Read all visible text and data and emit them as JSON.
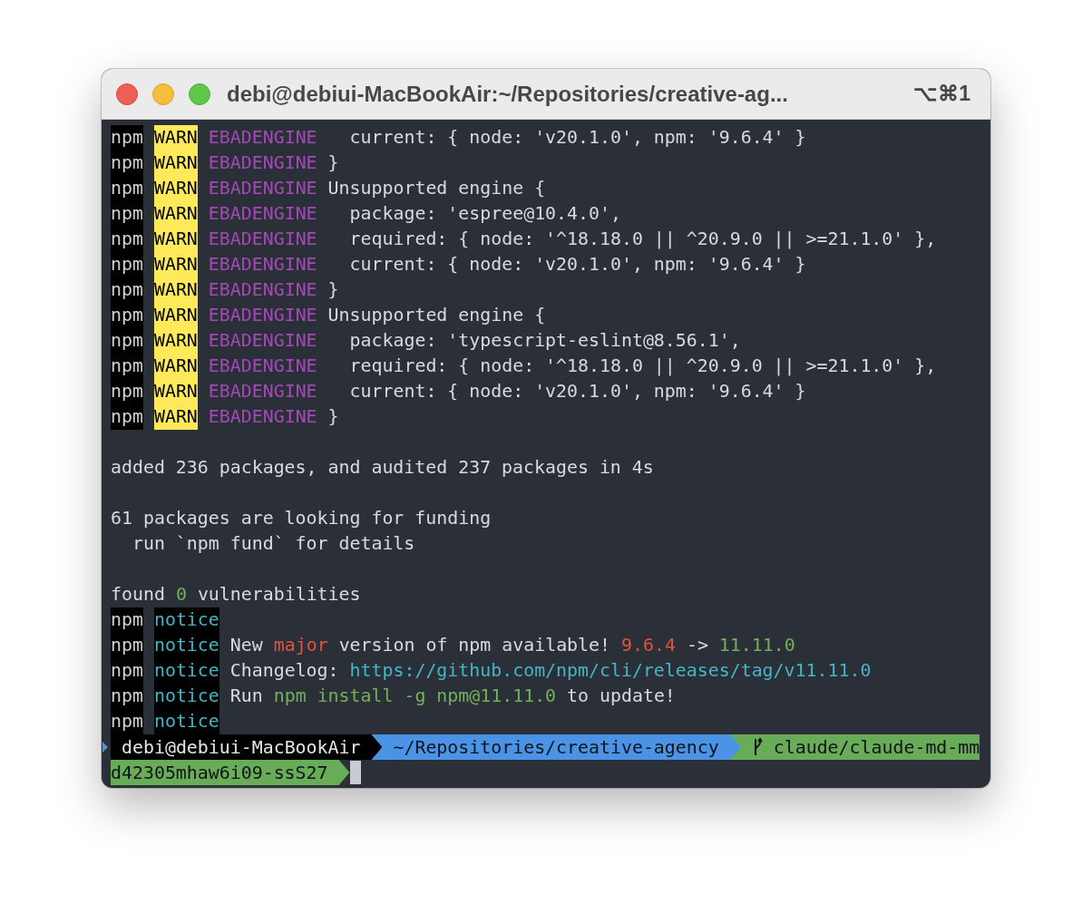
{
  "window": {
    "title": "debi@debiui-MacBookAir:~/Repositories/creative-ag...",
    "shortcut": "⌥⌘1"
  },
  "lines": [
    {
      "kind": "log",
      "segments": [
        {
          "kind": "prefix",
          "text": "npm"
        },
        {
          "kind": "warn",
          "text": "WARN"
        },
        {
          "kind": "code",
          "text": "EBADENGINE"
        },
        {
          "kind": "text",
          "text": "  current: { node: 'v20.1.0', npm: '9.6.4' }"
        }
      ]
    },
    {
      "kind": "log",
      "segments": [
        {
          "kind": "prefix",
          "text": "npm"
        },
        {
          "kind": "warn",
          "text": "WARN"
        },
        {
          "kind": "code",
          "text": "EBADENGINE"
        },
        {
          "kind": "text",
          "text": "}"
        }
      ]
    },
    {
      "kind": "log",
      "segments": [
        {
          "kind": "prefix",
          "text": "npm"
        },
        {
          "kind": "warn",
          "text": "WARN"
        },
        {
          "kind": "code",
          "text": "EBADENGINE"
        },
        {
          "kind": "text",
          "text": "Unsupported engine {"
        }
      ]
    },
    {
      "kind": "log",
      "segments": [
        {
          "kind": "prefix",
          "text": "npm"
        },
        {
          "kind": "warn",
          "text": "WARN"
        },
        {
          "kind": "code",
          "text": "EBADENGINE"
        },
        {
          "kind": "text",
          "text": "  package: 'espree@10.4.0',"
        }
      ]
    },
    {
      "kind": "log",
      "segments": [
        {
          "kind": "prefix",
          "text": "npm"
        },
        {
          "kind": "warn",
          "text": "WARN"
        },
        {
          "kind": "code",
          "text": "EBADENGINE"
        },
        {
          "kind": "text",
          "text": "  required: { node: '^18.18.0 || ^20.9.0 || >=21.1.0' },"
        }
      ]
    },
    {
      "kind": "log",
      "segments": [
        {
          "kind": "prefix",
          "text": "npm"
        },
        {
          "kind": "warn",
          "text": "WARN"
        },
        {
          "kind": "code",
          "text": "EBADENGINE"
        },
        {
          "kind": "text",
          "text": "  current: { node: 'v20.1.0', npm: '9.6.4' }"
        }
      ]
    },
    {
      "kind": "log",
      "segments": [
        {
          "kind": "prefix",
          "text": "npm"
        },
        {
          "kind": "warn",
          "text": "WARN"
        },
        {
          "kind": "code",
          "text": "EBADENGINE"
        },
        {
          "kind": "text",
          "text": "}"
        }
      ]
    },
    {
      "kind": "log",
      "segments": [
        {
          "kind": "prefix",
          "text": "npm"
        },
        {
          "kind": "warn",
          "text": "WARN"
        },
        {
          "kind": "code",
          "text": "EBADENGINE"
        },
        {
          "kind": "text",
          "text": "Unsupported engine {"
        }
      ]
    },
    {
      "kind": "log",
      "segments": [
        {
          "kind": "prefix",
          "text": "npm"
        },
        {
          "kind": "warn",
          "text": "WARN"
        },
        {
          "kind": "code",
          "text": "EBADENGINE"
        },
        {
          "kind": "text",
          "text": "  package: 'typescript-eslint@8.56.1',"
        }
      ]
    },
    {
      "kind": "log",
      "segments": [
        {
          "kind": "prefix",
          "text": "npm"
        },
        {
          "kind": "warn",
          "text": "WARN"
        },
        {
          "kind": "code",
          "text": "EBADENGINE"
        },
        {
          "kind": "text",
          "text": "  required: { node: '^18.18.0 || ^20.9.0 || >=21.1.0' },"
        }
      ]
    },
    {
      "kind": "log",
      "segments": [
        {
          "kind": "prefix",
          "text": "npm"
        },
        {
          "kind": "warn",
          "text": "WARN"
        },
        {
          "kind": "code",
          "text": "EBADENGINE"
        },
        {
          "kind": "text",
          "text": "  current: { node: 'v20.1.0', npm: '9.6.4' }"
        }
      ]
    },
    {
      "kind": "log",
      "segments": [
        {
          "kind": "prefix",
          "text": "npm"
        },
        {
          "kind": "warn",
          "text": "WARN"
        },
        {
          "kind": "code",
          "text": "EBADENGINE"
        },
        {
          "kind": "text",
          "text": "}"
        }
      ]
    },
    {
      "kind": "blank"
    },
    {
      "kind": "log",
      "segments": [
        {
          "kind": "text",
          "text": "added 236 packages, and audited 237 packages in 4s"
        }
      ]
    },
    {
      "kind": "blank"
    },
    {
      "kind": "log",
      "segments": [
        {
          "kind": "text",
          "text": "61 packages are looking for funding"
        }
      ]
    },
    {
      "kind": "log",
      "segments": [
        {
          "kind": "text",
          "text": "  run `npm fund` for details"
        }
      ]
    },
    {
      "kind": "blank"
    },
    {
      "kind": "log",
      "segments": [
        {
          "kind": "text",
          "text": "found"
        },
        {
          "kind": "green",
          "text": "0"
        },
        {
          "kind": "text",
          "text": "vulnerabilities"
        }
      ]
    },
    {
      "kind": "log",
      "segments": [
        {
          "kind": "prefix",
          "text": "npm"
        },
        {
          "kind": "notice",
          "text": "notice"
        }
      ]
    },
    {
      "kind": "log",
      "segments": [
        {
          "kind": "prefix",
          "text": "npm"
        },
        {
          "kind": "notice",
          "text": "notice"
        },
        {
          "kind": "text",
          "text": "New"
        },
        {
          "kind": "red",
          "text": "major"
        },
        {
          "kind": "text",
          "text": "version of npm available!"
        },
        {
          "kind": "red",
          "text": "9.6.4"
        },
        {
          "kind": "text",
          "text": "->"
        },
        {
          "kind": "green",
          "text": "11.11.0"
        }
      ]
    },
    {
      "kind": "log",
      "segments": [
        {
          "kind": "prefix",
          "text": "npm"
        },
        {
          "kind": "notice",
          "text": "notice"
        },
        {
          "kind": "text",
          "text": "Changelog:"
        },
        {
          "kind": "link",
          "text": "https://github.com/npm/cli/releases/tag/v11.11.0"
        }
      ]
    },
    {
      "kind": "log",
      "segments": [
        {
          "kind": "prefix",
          "text": "npm"
        },
        {
          "kind": "notice",
          "text": "notice"
        },
        {
          "kind": "text",
          "text": "Run"
        },
        {
          "kind": "green",
          "text": "npm install -g npm@11.11.0"
        },
        {
          "kind": "text",
          "text": "to update!"
        }
      ]
    },
    {
      "kind": "log",
      "segments": [
        {
          "kind": "prefix",
          "text": "npm"
        },
        {
          "kind": "notice",
          "text": "notice"
        }
      ]
    }
  ],
  "prompt": {
    "user": "debi@debiui-MacBookAir",
    "path": "~/Repositories/creative-agency",
    "branch": "claude/claude-md-mm",
    "branch_continued": "d42305mhaw6i09-ssS27"
  }
}
